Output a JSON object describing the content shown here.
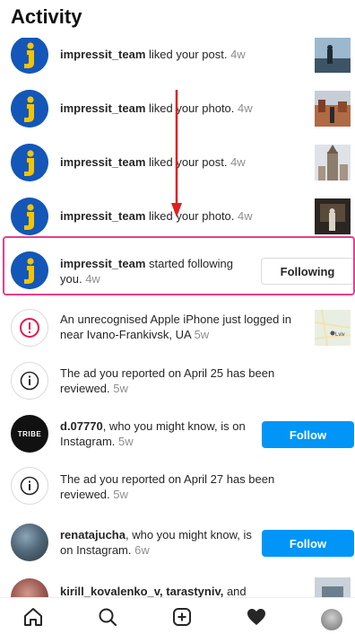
{
  "header": {
    "title": "Activity"
  },
  "notifications": [
    {
      "user": "impressit_team",
      "text": " liked your post.",
      "time": "4w"
    },
    {
      "user": "impressit_team",
      "text": " liked your photo.",
      "time": "4w"
    },
    {
      "user": "impressit_team",
      "text": " liked your post.",
      "time": "4w"
    },
    {
      "user": "impressit_team",
      "text": " liked your photo.",
      "time": "4w"
    },
    {
      "user": "impressit_team",
      "text": " started following you.",
      "time": "4w",
      "button": "Following"
    },
    {
      "text": "An unrecognised Apple iPhone just logged in near Ivano-Frankivsk, UA",
      "time": "5w"
    },
    {
      "text": "The ad you reported on April 25 has been reviewed.",
      "time": "5w"
    },
    {
      "user": "d.07770",
      "text": ", who you might know, is on Instagram.",
      "time": "5w",
      "button": "Follow"
    },
    {
      "text": "The ad you reported on April 27 has been reviewed.",
      "time": "5w"
    },
    {
      "user": "renatajucha",
      "text": ", who you might know, is on Instagram.",
      "time": "6w",
      "button": "Follow"
    },
    {
      "user": "kirill_kovalenko_v, tarastyniv,",
      "text": " and"
    }
  ],
  "map_label": "Lviv",
  "avatar_label": "TRIBE",
  "colors": {
    "follow_blue": "#0095f6",
    "highlight_pink": "#e83e8c",
    "arrow_red": "#e0201e",
    "brand_blue": "#1457b8",
    "brand_yellow": "#f5c400"
  },
  "nav": [
    "home-icon",
    "search-icon",
    "add-post-icon",
    "heart-icon",
    "profile-avatar"
  ]
}
